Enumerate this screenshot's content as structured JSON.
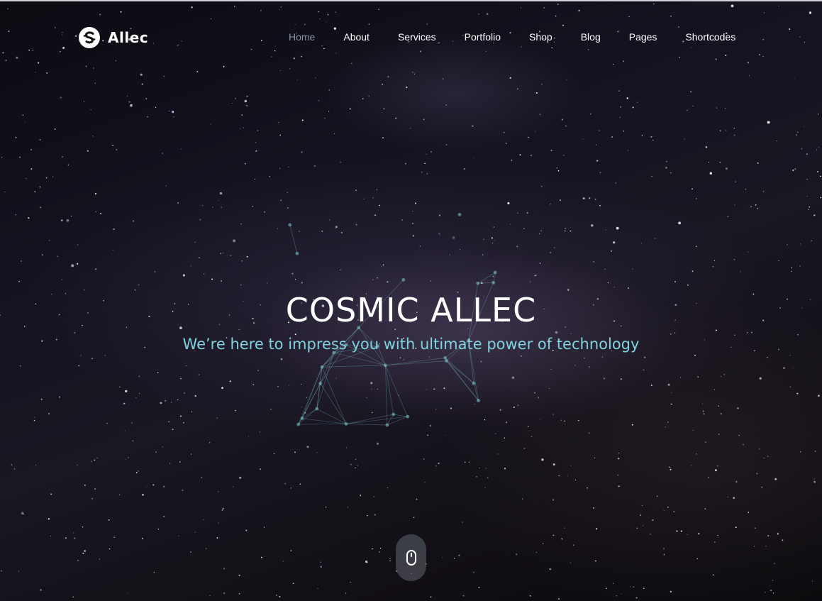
{
  "brand": {
    "name": "Allec",
    "logo_icon": "s-circle-logo-icon"
  },
  "nav": {
    "items": [
      {
        "label": "Home",
        "active": true
      },
      {
        "label": "About",
        "active": false
      },
      {
        "label": "Services",
        "active": false
      },
      {
        "label": "Portfolio",
        "active": false
      },
      {
        "label": "Shop",
        "active": false
      },
      {
        "label": "Blog",
        "active": false
      },
      {
        "label": "Pages",
        "active": false
      },
      {
        "label": "Shortcodes",
        "active": false
      }
    ]
  },
  "hero": {
    "title": "COSMIC ALLEC",
    "subtitle": "We’re here to impress you with ultimate power of technology",
    "scroll_icon": "mouse-scroll-icon"
  },
  "colors": {
    "accent": "#7ed3df",
    "nav_active": "#8690a3",
    "text": "#ffffff"
  }
}
